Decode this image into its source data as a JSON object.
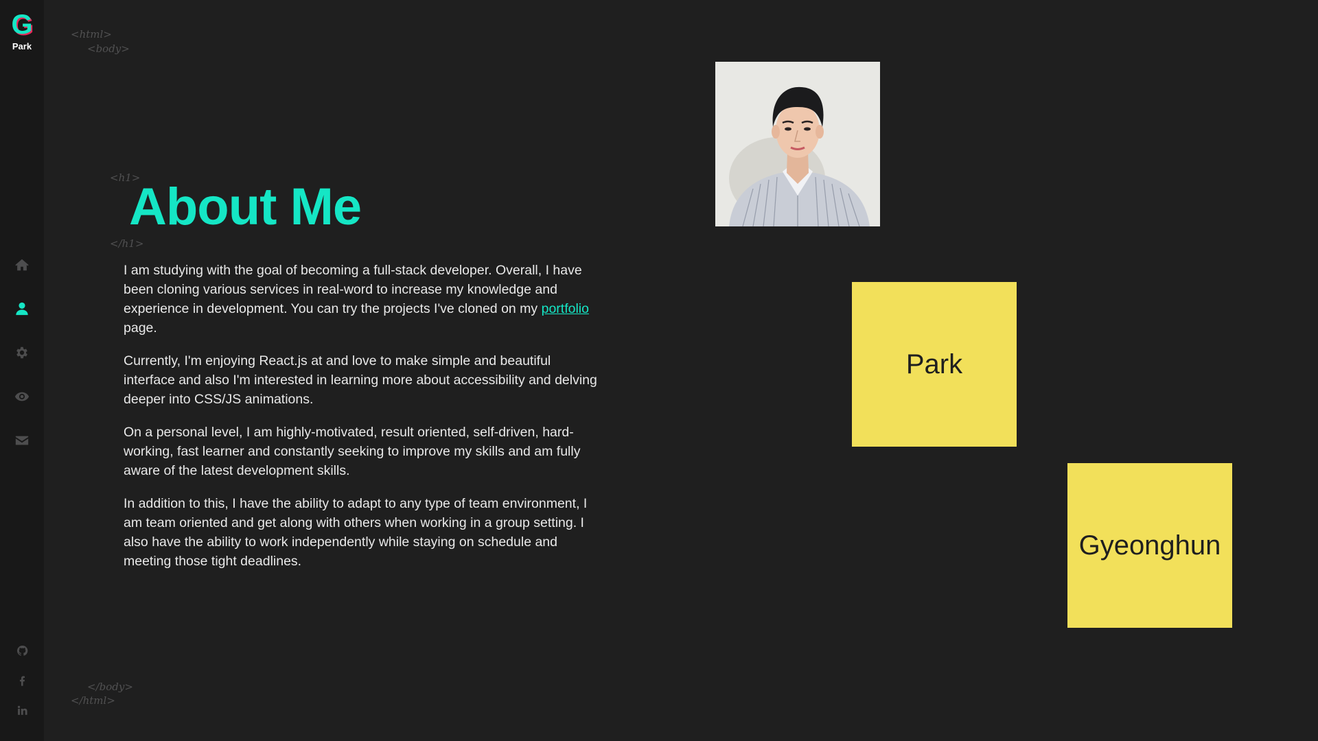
{
  "brand": {
    "logo_letter": "G",
    "name": "Park"
  },
  "nav": {
    "items": [
      {
        "icon": "home-icon",
        "active": false
      },
      {
        "icon": "user-icon",
        "active": true
      },
      {
        "icon": "gear-icon",
        "active": false
      },
      {
        "icon": "eye-icon",
        "active": false
      },
      {
        "icon": "envelope-icon",
        "active": false
      }
    ]
  },
  "social": {
    "items": [
      {
        "icon": "github-icon"
      },
      {
        "icon": "facebook-icon"
      },
      {
        "icon": "linkedin-icon"
      }
    ]
  },
  "tags": {
    "html_open": "<html>",
    "body_open": "<body>",
    "h1_open": "<h1>",
    "h1_close": "</h1>",
    "body_close": "</body>",
    "html_close": "</html>"
  },
  "about": {
    "title": "About Me",
    "p1_before": "I am studying with the goal of becoming a full-stack developer. Overall, I have been cloning various services in real-word to increase my knowledge and experience in development. You can try the projects I've cloned on my ",
    "p1_link": "portfolio",
    "p1_after": " page.",
    "p2": "Currently, I'm enjoying React.js at and love to make simple and beautiful interface and also I'm interested in learning more about accessibility and delving deeper into CSS/JS animations.",
    "p3": "On a personal level, I am highly-motivated, result oriented, self-driven, hard-working, fast learner and constantly seeking to improve my skills and am fully aware of the latest development skills.",
    "p4": "In addition to this, I have the ability to adapt to any type of team environment, I am team oriented and get along with others when working in a group setting. I also have the ability to work independently while staying on schedule and meeting those tight deadlines."
  },
  "notes": {
    "first": "Park",
    "second": "Gyeonghun"
  },
  "colors": {
    "accent": "#15e6c5",
    "background": "#1f1f1f",
    "sidebar": "#181818",
    "note": "#f2e05a",
    "inactive_icon": "#4d4d4e"
  }
}
